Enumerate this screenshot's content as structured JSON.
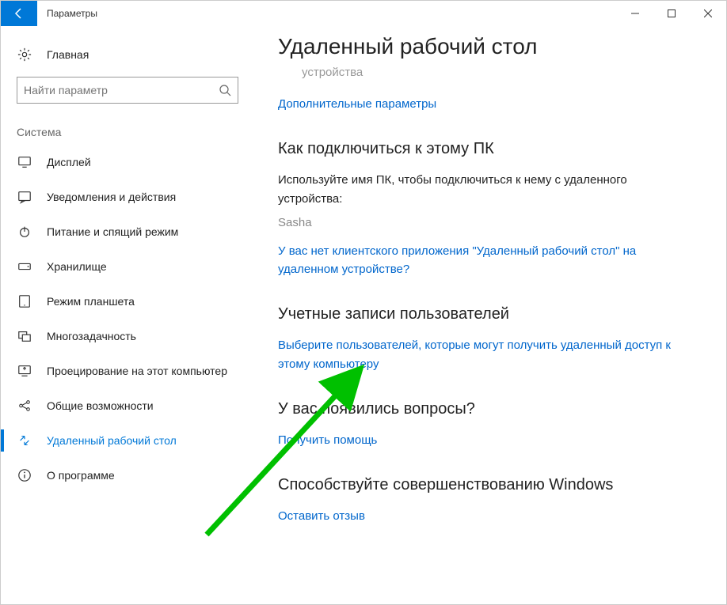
{
  "titlebar": {
    "app_title": "Параметры"
  },
  "sidebar": {
    "home_label": "Главная",
    "search_placeholder": "Найти параметр",
    "group_label": "Система",
    "items": [
      {
        "label": "Дисплей"
      },
      {
        "label": "Уведомления и действия"
      },
      {
        "label": "Питание и спящий режим"
      },
      {
        "label": "Хранилище"
      },
      {
        "label": "Режим планшета"
      },
      {
        "label": "Многозадачность"
      },
      {
        "label": "Проецирование на этот компьютер"
      },
      {
        "label": "Общие возможности"
      },
      {
        "label": "Удаленный рабочий стол"
      },
      {
        "label": "О программе"
      }
    ]
  },
  "main": {
    "page_title": "Удаленный рабочий стол",
    "muted_sub": "устройства",
    "link_additional": "Дополнительные параметры",
    "section_connect_title": "Как подключиться к этому ПК",
    "connect_desc": "Используйте имя ПК, чтобы подключиться к нему с удаленного устройства:",
    "pc_name": "Sasha",
    "link_no_client": "У вас нет клиентского приложения \"Удаленный рабочий стол\" на удаленном устройстве?",
    "section_accounts_title": "Учетные записи пользователей",
    "link_select_users": "Выберите пользователей, которые могут получить удаленный доступ к этому компьютеру",
    "section_questions_title": "У вас появились вопросы?",
    "link_help": "Получить помощь",
    "section_improve_title": "Способствуйте совершенствованию Windows",
    "link_feedback": "Оставить отзыв"
  }
}
